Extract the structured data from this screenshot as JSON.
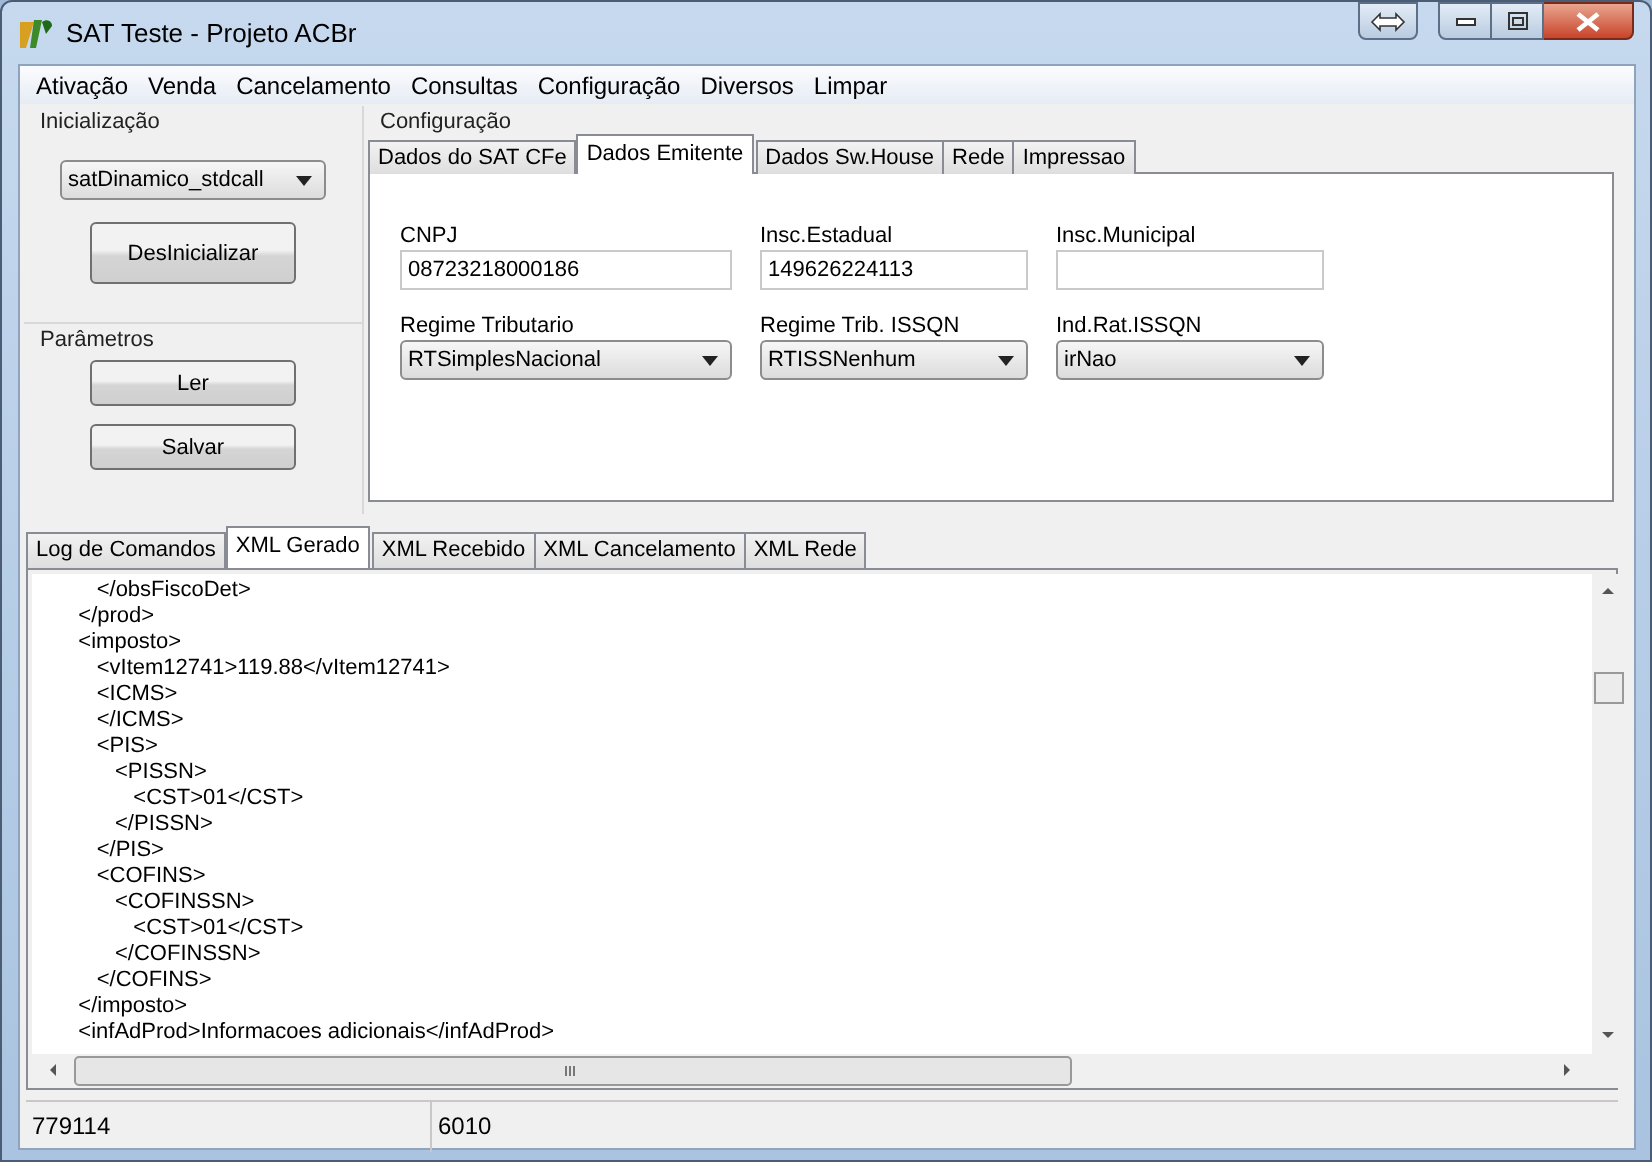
{
  "window": {
    "title": "SAT Teste - Projeto ACBr"
  },
  "menu": [
    "Ativação",
    "Venda",
    "Cancelamento",
    "Consultas",
    "Configuração",
    "Diversos",
    "Limpar"
  ],
  "inicializacao": {
    "title": "Inicialização",
    "library": "satDinamico_stdcall",
    "button": "DesInicializar"
  },
  "parametros": {
    "title": "Parâmetros",
    "buttons": [
      "Ler",
      "Salvar"
    ]
  },
  "configuracao": {
    "title": "Configuração",
    "tabs": [
      {
        "label": "Dados do SAT CFe",
        "selected": false
      },
      {
        "label": "Dados Emitente",
        "selected": true
      },
      {
        "label": "Dados Sw.House",
        "selected": false
      },
      {
        "label": "Rede",
        "selected": false
      },
      {
        "label": "Impressao",
        "selected": false
      }
    ],
    "fields": [
      {
        "kind": "text",
        "label": "CNPJ",
        "value": "08723218000186"
      },
      {
        "kind": "text",
        "label": "Insc.Estadual",
        "value": "149626224113"
      },
      {
        "kind": "text",
        "label": "Insc.Municipal"
      },
      {
        "kind": "combo",
        "label": "Regime Tributario",
        "value": "RTSimplesNacional"
      },
      {
        "kind": "combo",
        "label": "Regime Trib. ISSQN",
        "value": "RTISSNenhum"
      },
      {
        "kind": "combo",
        "label": "Ind.Rat.ISSQN",
        "value": "irNao"
      }
    ]
  },
  "output": {
    "tabs": [
      {
        "label": "Log de Comandos",
        "selected": false
      },
      {
        "label": "XML Gerado",
        "selected": true
      },
      {
        "label": "XML Recebido",
        "selected": false
      },
      {
        "label": "XML Cancelamento",
        "selected": false
      },
      {
        "label": "XML Rede",
        "selected": false
      }
    ],
    "lines": [
      "      </obsFiscoDet>",
      "   </prod>",
      "   <imposto>",
      "      <vItem12741>119.88</vItem12741>",
      "      <ICMS>",
      "      </ICMS>",
      "      <PIS>",
      "         <PISSN>",
      "            <CST>01</CST>",
      "         </PISSN>",
      "      </PIS>",
      "      <COFINS>",
      "         <COFINSSN>",
      "            <CST>01</CST>",
      "         </COFINSSN>",
      "      </COFINS>",
      "   </imposto>",
      "   <infAdProd>Informacoes adicionais</infAdProd>"
    ]
  },
  "status_bar": [
    "779114",
    "6010"
  ]
}
